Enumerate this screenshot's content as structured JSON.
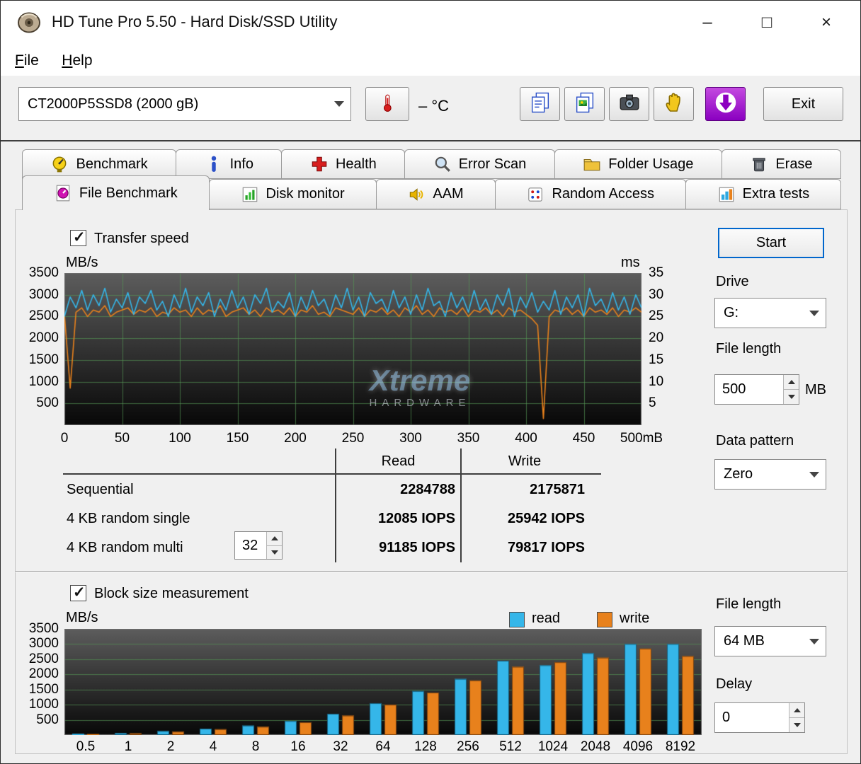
{
  "window": {
    "title": "HD Tune Pro 5.50 - Hard Disk/SSD Utility",
    "minimize": "–",
    "maximize": "□",
    "close": "×"
  },
  "menu": {
    "file": "File",
    "help": "Help"
  },
  "toolbar": {
    "device_select": "CT2000P5SSD8 (2000 gB)",
    "temperature": "– °C",
    "exit": "Exit"
  },
  "tabs": {
    "row1": [
      {
        "label": "Benchmark",
        "icon": "benchmark-icon"
      },
      {
        "label": "Info",
        "icon": "info-icon"
      },
      {
        "label": "Health",
        "icon": "health-icon"
      },
      {
        "label": "Error Scan",
        "icon": "error-scan-icon"
      },
      {
        "label": "Folder Usage",
        "icon": "folder-usage-icon"
      },
      {
        "label": "Erase",
        "icon": "erase-icon"
      }
    ],
    "row2": [
      {
        "label": "File Benchmark",
        "icon": "file-benchmark-icon",
        "active": true
      },
      {
        "label": "Disk monitor",
        "icon": "disk-monitor-icon"
      },
      {
        "label": "AAM",
        "icon": "aam-icon"
      },
      {
        "label": "Random Access",
        "icon": "random-access-icon"
      },
      {
        "label": "Extra tests",
        "icon": "extra-tests-icon"
      }
    ]
  },
  "file_benchmark": {
    "transfer_speed_label": "Transfer speed",
    "start_button": "Start",
    "drive_label": "Drive",
    "drive_value": "G:",
    "file_length_label": "File length",
    "file_length_value": "500",
    "file_length_unit": "MB",
    "data_pattern_label": "Data pattern",
    "data_pattern_value": "Zero",
    "results": {
      "read_header": "Read",
      "write_header": "Write",
      "rows": [
        {
          "label": "Sequential",
          "read": "2284788",
          "write": "2175871"
        },
        {
          "label": "4 KB random single",
          "read": "12085 IOPS",
          "write": "25942 IOPS"
        },
        {
          "label": "4 KB random multi",
          "multi_value": "32",
          "read": "91185 IOPS",
          "write": "79817 IOPS"
        }
      ]
    }
  },
  "block_size": {
    "label": "Block size measurement",
    "legend_read": "read",
    "legend_write": "write",
    "file_length_label": "File length",
    "file_length_value": "64 MB",
    "delay_label": "Delay",
    "delay_value": "0"
  },
  "watermark": {
    "line1": "Xtreme",
    "line2": "HARDWARE"
  },
  "chart_data": [
    {
      "type": "line",
      "title": "Transfer speed",
      "ylabel_left": "MB/s",
      "ylabel_right": "ms",
      "xlim": [
        0,
        500
      ],
      "ylim_left": [
        0,
        3500
      ],
      "ylim_right": [
        0,
        35
      ],
      "x_step": 5,
      "x_tick_labels": [
        "0",
        "50",
        "100",
        "150",
        "200",
        "250",
        "300",
        "350",
        "400",
        "450",
        "500mB"
      ],
      "y_ticks_left": [
        3500,
        3000,
        2500,
        2000,
        1500,
        1000,
        500
      ],
      "y_ticks_right": [
        35,
        30,
        25,
        20,
        15,
        10,
        5
      ],
      "grid": true,
      "series": [
        {
          "name": "read",
          "color": "#35b6e9",
          "values": [
            2500,
            2950,
            2700,
            3100,
            2650,
            3000,
            2750,
            3150,
            2600,
            2900,
            2700,
            3050,
            2550,
            2950,
            2800,
            3100,
            2650,
            2850,
            2500,
            3000,
            2700,
            3150,
            2600,
            2950,
            2750,
            3050,
            2500,
            2900,
            2650,
            3100,
            2700,
            2950,
            2550,
            3000,
            2800,
            3150,
            2600,
            2850,
            2700,
            3050,
            2500,
            2950,
            2650,
            3100,
            2750,
            2900,
            2550,
            3000,
            2700,
            3150,
            2650,
            2950,
            2500,
            3050,
            2800,
            2900,
            2600,
            3100,
            2700,
            2950,
            2550,
            3000,
            2650,
            3150,
            2750,
            2850,
            2500,
            3050,
            2700,
            2950,
            2600,
            3100,
            2650,
            2900,
            2550,
            3000,
            2750,
            3150,
            2500,
            2950,
            2700,
            3050,
            2600,
            2850,
            2650,
            3100,
            2550,
            2950,
            2700,
            3000,
            2500,
            3150,
            2750,
            2900,
            2600,
            3050,
            2650,
            2950,
            2550,
            3000,
            2700
          ]
        },
        {
          "name": "write",
          "color": "#e8811c",
          "values": [
            2550,
            850,
            2600,
            2700,
            2500,
            2650,
            2600,
            2750,
            2500,
            2600,
            2650,
            2700,
            2550,
            2650,
            2600,
            2700,
            2500,
            2600,
            2550,
            2700,
            2600,
            2650,
            2500,
            2700,
            2550,
            2650,
            2600,
            2750,
            2500,
            2600,
            2650,
            2700,
            2550,
            2650,
            2500,
            2700,
            2600,
            2650,
            2550,
            2700,
            2500,
            2650,
            2600,
            2750,
            2550,
            2600,
            2500,
            2700,
            2650,
            2600,
            2550,
            2700,
            2500,
            2650,
            2600,
            2700,
            2550,
            2650,
            2500,
            2700,
            2600,
            2750,
            2550,
            2650,
            2500,
            2700,
            2600,
            2650,
            2550,
            2700,
            2500,
            2650,
            2600,
            2700,
            2550,
            2650,
            2500,
            2700,
            2600,
            2650,
            2550,
            2450,
            2300,
            150,
            2500,
            2650,
            2600,
            2700,
            2550,
            2650,
            2500,
            2700,
            2600,
            2650,
            2550,
            2700,
            2500,
            2650,
            2600,
            2700,
            2600
          ]
        }
      ]
    },
    {
      "type": "bar",
      "title": "Block size measurement",
      "ylabel": "MB/s",
      "ylim": [
        0,
        3500
      ],
      "y_ticks": [
        3500,
        3000,
        2500,
        2000,
        1500,
        1000,
        500
      ],
      "categories": [
        "0.5",
        "1",
        "2",
        "4",
        "8",
        "16",
        "32",
        "64",
        "128",
        "256",
        "512",
        "1024",
        "2048",
        "4096",
        "8192"
      ],
      "grid": true,
      "legend_position": "top-right",
      "series": [
        {
          "name": "read",
          "color": "#35b6e9",
          "values": [
            40,
            70,
            130,
            210,
            310,
            460,
            700,
            1050,
            1450,
            1850,
            2450,
            2300,
            2700,
            3000,
            3000
          ]
        },
        {
          "name": "write",
          "color": "#e8811c",
          "values": [
            30,
            55,
            110,
            190,
            270,
            420,
            640,
            1000,
            1400,
            1800,
            2250,
            2400,
            2550,
            2850,
            2600
          ]
        }
      ]
    }
  ]
}
